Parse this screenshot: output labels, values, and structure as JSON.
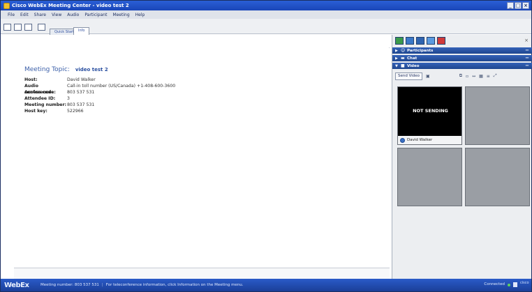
{
  "window": {
    "title": "Cisco WebEx Meeting Center - video test 2",
    "controls": [
      "minimize",
      "maximize",
      "close"
    ]
  },
  "menu": [
    "File",
    "Edit",
    "Share",
    "View",
    "Audio",
    "Participant",
    "Meeting",
    "Help"
  ],
  "tabs": [
    {
      "label": "Quick Start",
      "active": false
    },
    {
      "label": "Info",
      "active": true
    }
  ],
  "meeting": {
    "topic_label": "Meeting Topic:",
    "topic_value": "video test 2",
    "rows": [
      {
        "label": "Host:",
        "value": "David Walker"
      },
      {
        "label": "Audio conference:",
        "value": "Call-in toll number (US/Canada)  +1-408-600-3600"
      },
      {
        "label": "Access code:",
        "value": "803 537 531"
      },
      {
        "label": "Attendee ID:",
        "value": "3"
      },
      {
        "label": "Meeting number:",
        "value": "803 537 531"
      },
      {
        "label": "Host key:",
        "value": "522966"
      }
    ]
  },
  "panels": {
    "participants": "Participants",
    "chat": "Chat",
    "video": "Video"
  },
  "video": {
    "send_video": "Send Video",
    "self_status": "NOT SENDING",
    "self_name": "David Walker"
  },
  "status": {
    "logo": "WebEx",
    "meeting_number": "Meeting number: 803 537 531",
    "teleconf": "For teleconference information, click Information on the Meeting menu.",
    "connection": "Connected",
    "cisco": "cisco"
  },
  "colors": {
    "titlebar": "#2a5fd6",
    "panel_header": "#2f5aaa",
    "status_connected": "#5fd25f"
  }
}
